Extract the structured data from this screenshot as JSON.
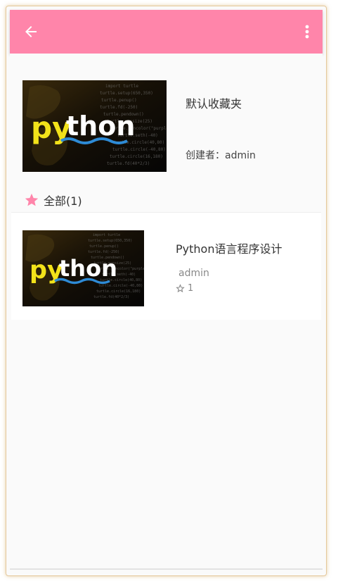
{
  "colors": {
    "appbar": "#ff85aa",
    "accent_star": "#ff85aa",
    "background": "#fafafa"
  },
  "appbar": {
    "back_icon": "arrow-left-icon",
    "menu_icon": "more-vert-icon"
  },
  "folder": {
    "name": "默认收藏夹",
    "creator_label": "创建者：",
    "creator": "admin",
    "cover_text": "python"
  },
  "section": {
    "icon": "star-icon",
    "label": "全部(1)"
  },
  "items": [
    {
      "title": "Python语言程序设计",
      "author": "admin",
      "star_icon": "star-outline-icon",
      "stars": "1",
      "cover_text": "python"
    }
  ]
}
